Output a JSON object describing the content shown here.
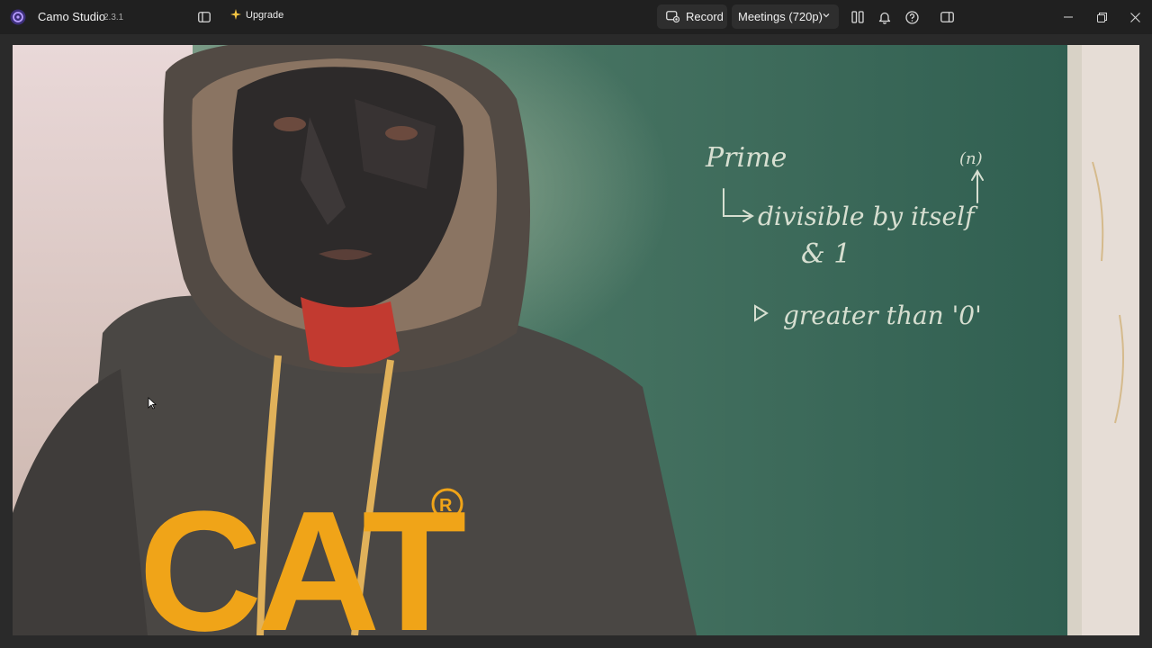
{
  "app": {
    "name": "Camo Studio",
    "version": "2.3.1"
  },
  "toolbar": {
    "upgrade_label": "Upgrade",
    "record_label": "Record",
    "output_selected": "Meetings (720p)"
  },
  "icons": {
    "logo": "camo-logo-icon",
    "sidebar": "sidebar-toggle-icon",
    "upgrade": "sparkle-icon",
    "record": "record-icon",
    "layout": "split-layout-icon",
    "notifications": "bell-icon",
    "help": "help-icon",
    "panel": "right-panel-icon",
    "minimize": "minimize-icon",
    "maximize": "restore-icon",
    "close": "close-icon"
  },
  "colors": {
    "titlebar": "#202020",
    "button_bg": "#2e2e2e",
    "accent": "#8b5cf6",
    "upgrade_star": "#f5c542",
    "chalkboard": "#3b6658",
    "hoodie": "#4a4744",
    "cat_logo": "#f0a418"
  },
  "video": {
    "hoodie_text": "CAT",
    "chalk_lines": [
      "Prime",
      "↳ divisible by itself",
      "& 1",
      "▷ greater than '0'",
      "(n)"
    ]
  }
}
